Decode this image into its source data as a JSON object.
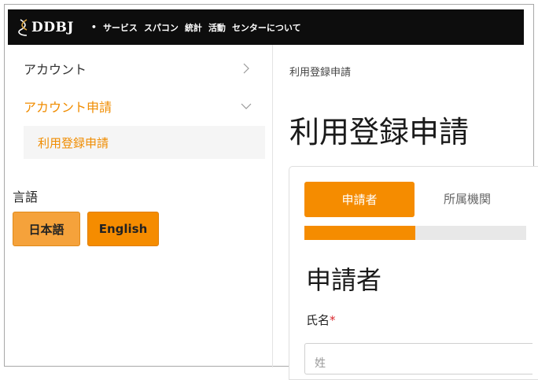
{
  "header": {
    "logo_text": "DDBJ",
    "nav_bullet": "•",
    "nav_items": [
      "サービス",
      "スパコン",
      "統計",
      "活動",
      "センターについて"
    ]
  },
  "sidebar": {
    "items": [
      {
        "label": "アカウント",
        "icon": "chevron-right-icon"
      },
      {
        "label": "アカウント申請",
        "icon": "chevron-down-icon"
      }
    ],
    "subitem": "利用登録申請",
    "language_label": "言語",
    "language_options": [
      "日本語",
      "English"
    ]
  },
  "main": {
    "breadcrumb": "利用登録申請",
    "title": "利用登録申請",
    "tabs": [
      "申請者",
      "所属機関"
    ],
    "progress_fraction": 0.5,
    "section_title": "申請者",
    "name_label": "氏名",
    "required_mark": "*",
    "name_placeholder": "姓"
  },
  "colors": {
    "accent": "#f58c00",
    "accent_light": "#f5a23b",
    "header_bg": "#0d0d0d",
    "required": "#d9262c"
  }
}
